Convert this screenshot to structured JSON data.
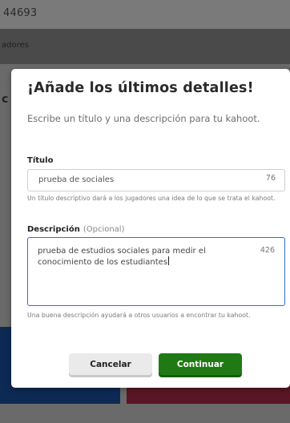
{
  "background": {
    "game_pin": "44693",
    "row_text": "adores",
    "partial_letter": "c"
  },
  "modal": {
    "title": "¡Añade los últimos detalles!",
    "subtitle": "Escribe un título y una descripción para tu kahoot.",
    "title_field": {
      "label": "Título",
      "value": "prueba de sociales",
      "char_count": "76",
      "hint": "Un título descriptivo dará a los jugadores una idea de lo que se trata el kahoot."
    },
    "description_field": {
      "label": "Descripción",
      "optional_label": "(Opcional)",
      "value": "prueba de estudios sociales para medir el conocimiento de los estudiantes",
      "char_count": "426",
      "hint": "Una buena descripción ayudará a otros usuarios a encontrar tu kahoot."
    },
    "buttons": {
      "cancel": "Cancelar",
      "continue": "Continuar"
    }
  },
  "colors": {
    "continue_button": "#1f7a13",
    "focus_border": "#2e6edd",
    "card_blue": "#0d2a55",
    "card_red": "#5a1625"
  }
}
